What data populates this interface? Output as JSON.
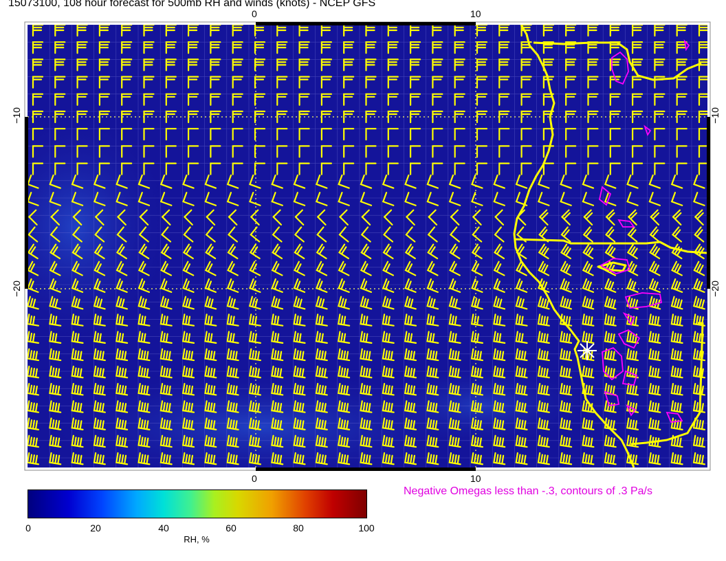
{
  "title": "15073100, 108 hour forecast for 500mb RH and winds (knots) - NCEP GFS",
  "axes": {
    "x_ticks_top": [
      "0",
      "10"
    ],
    "x_ticks_bottom": [
      "0",
      "10"
    ],
    "y_ticks_left": [
      "−10",
      "−20"
    ],
    "y_ticks_right": [
      "−10",
      "−20"
    ]
  },
  "colorbar": {
    "ticks": [
      "0",
      "20",
      "40",
      "60",
      "80",
      "100"
    ],
    "label": "RH, %",
    "min": 0,
    "max": 100
  },
  "omega_note": "Negative Omegas less than -.3, contours of .3 Pa/s",
  "colors": {
    "background_field": "#1a1aa0",
    "barb_color": "#ffff00",
    "coastline_color": "#ffff00",
    "omega_color": "#ff00ff",
    "marker_color": "#ffffff"
  },
  "marker": {
    "name": "location-star-icon",
    "lon": 15,
    "lat": -23
  }
}
